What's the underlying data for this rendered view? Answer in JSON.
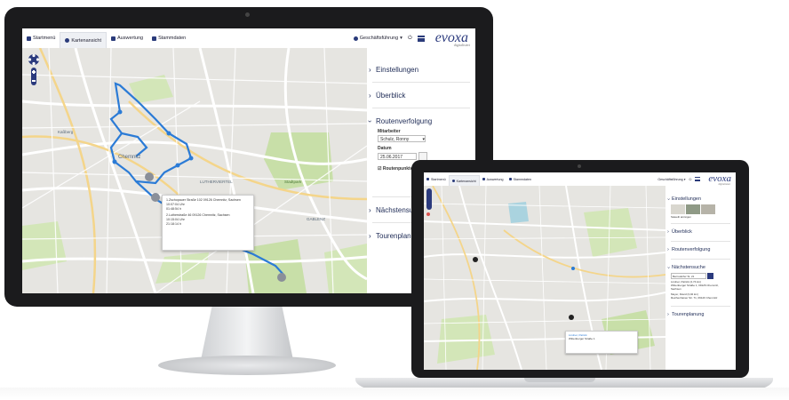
{
  "nav": {
    "items": [
      {
        "label": "Startmenü",
        "icon": "home-icon"
      },
      {
        "label": "Kartenansicht",
        "icon": "globe-icon",
        "active": true
      },
      {
        "label": "Auswertung",
        "icon": "chart-icon"
      },
      {
        "label": "Stammdaten",
        "icon": "book-icon"
      }
    ],
    "user_label": "Geschäftsführung",
    "logo_text": "evoxa",
    "logo_sub": "digitalisiert"
  },
  "desktop": {
    "sidebar": {
      "settings": "Einstellungen",
      "overview": "Überblick",
      "route_tracking": "Routenverfolgung",
      "employee_label": "Mitarbeiter",
      "employee_value": "Schulz, Ronny",
      "date_label": "Datum",
      "date_value": "25.06.2017",
      "route_points_label": "Routenpunkte",
      "nearest_search": "Nächstensu",
      "tour_planning": "Tourenplan"
    },
    "popup": {
      "lines": [
        "1.Zschopauer Straße 102 09126 Chemnitz, Sachsen",
        "10:07:04 Uhr",
        "01:48:54 h",
        "2.Lutherstraße 46 09126 Chemnitz, Sachsen",
        "10:15:04 Uhr",
        "21:18:14 h"
      ]
    },
    "map_labels": [
      "Chemnitz",
      "LUTHERVIERTEL",
      "GABLENZ",
      "Stadtpark",
      "Kaßberg"
    ]
  },
  "laptop": {
    "sidebar": {
      "settings": "Einstellungen",
      "satellite_label": "Sateelit anzeigen",
      "overview": "Überblick",
      "route_tracking": "Routenverfolgung",
      "nearest_search": "Nächstensuche",
      "search_value": "Bernsdorfer St. 21",
      "result_1": "Lindner, Patrick (2,74 km)",
      "result_1_addr": "Wittenberger Straße 1, 09126 Chemnitz, Sachsen",
      "result_2": "Meyer, David (3,02 km)",
      "result_2_addr": "Reichenhainer Str. 71, 09126 Chemnitz",
      "tour_planning": "Tourenplanung"
    },
    "popup": {
      "lines": [
        "Lindner, Patrick",
        "Wittenberger Straße 1"
      ]
    }
  },
  "colors": {
    "brand": "#2b3a7d",
    "route": "#2b7bd6",
    "park": "#c8dfa8",
    "water": "#aad3df"
  }
}
